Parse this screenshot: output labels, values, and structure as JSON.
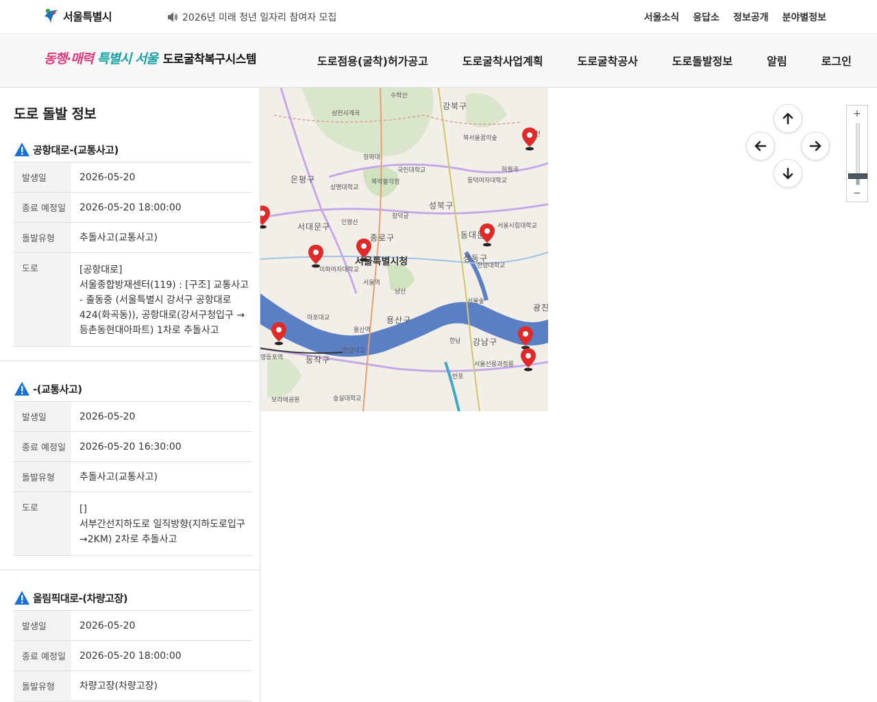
{
  "header": {
    "seoul_logo_text": "서울특별시",
    "notice_text": "2026년 미래 청년 일자리 참여자 모집",
    "util_links": [
      "서울소식",
      "응답소",
      "정보공개",
      "분야별정보"
    ]
  },
  "nav": {
    "slogan_part1": "동행·매력",
    "slogan_part2": "특별시 서울",
    "system_title": "도로굴착복구시스템",
    "menu": [
      "도로점용(굴착)허가공고",
      "도로굴착사업계획",
      "도로굴착공사",
      "도로돌발정보",
      "알림",
      "로그인"
    ]
  },
  "panel": {
    "title": "도로 돌발 정보",
    "incidents": [
      {
        "title": "공항대로-(교통사고)",
        "rows": [
          {
            "label": "발생일",
            "value": "2026-05-20"
          },
          {
            "label": "종료 예정일",
            "value": "2026-05-20 18:00:00"
          },
          {
            "label": "돌발유형",
            "value": "추돌사고(교통사고)"
          },
          {
            "label": "도로",
            "value_road": "[공항대로]",
            "value_desc": "서울종합방재센터(119) : [구조] 교통사고 - 출동중 (서울특별시 강서구 공항대로 424(화곡동)), 공항대로(강서구청입구 → 등촌동현대아파트) 1차로 추돌사고"
          }
        ]
      },
      {
        "title": "-(교통사고)",
        "rows": [
          {
            "label": "발생일",
            "value": "2026-05-20"
          },
          {
            "label": "종료 예정일",
            "value": "2026-05-20 16:30:00"
          },
          {
            "label": "돌발유형",
            "value": "추돌사고(교통사고)"
          },
          {
            "label": "도로",
            "value_road": "[]",
            "value_desc": "서부간선지하도로 일직방향(지하도로입구→2KM) 2차로 추돌사고"
          }
        ]
      },
      {
        "title": "올림픽대로-(차량고장)",
        "rows": [
          {
            "label": "발생일",
            "value": "2026-05-20"
          },
          {
            "label": "종료 예정일",
            "value": "2026-05-20 18:00:00"
          },
          {
            "label": "돌발유형",
            "value": "차량고장(차량고장)"
          }
        ]
      }
    ]
  },
  "map": {
    "districts": [
      "강북구",
      "은평구",
      "성북구",
      "서대문구",
      "종로구",
      "동대문구",
      "성동구",
      "용산구",
      "강남구",
      "동작구",
      "광진구"
    ],
    "city_hall": "서울특별시청",
    "places": [
      "북서울꿈의숲",
      "국민대학교",
      "북악팔각정",
      "상명대학교",
      "인왕산",
      "창덕궁",
      "이화여자대학교",
      "서울역",
      "남산",
      "용산역",
      "한남",
      "반포",
      "서울선릉과정릉",
      "보라매공원",
      "숭실대학교",
      "한양대학교",
      "서울숲",
      "하월곡",
      "삼천사계곡",
      "수락산",
      "동덕여자대학교",
      "서울시립대학교",
      "마포대교",
      "한강대교",
      "영등포역",
      "청와대",
      "중랑천"
    ],
    "controls": {
      "zoom_in": "+",
      "zoom_out": "−",
      "zoom_level": 0.15
    },
    "colors": {
      "water": "#5b7fc4",
      "pin": "#e02a2a",
      "park": "#cfe3c0"
    }
  }
}
